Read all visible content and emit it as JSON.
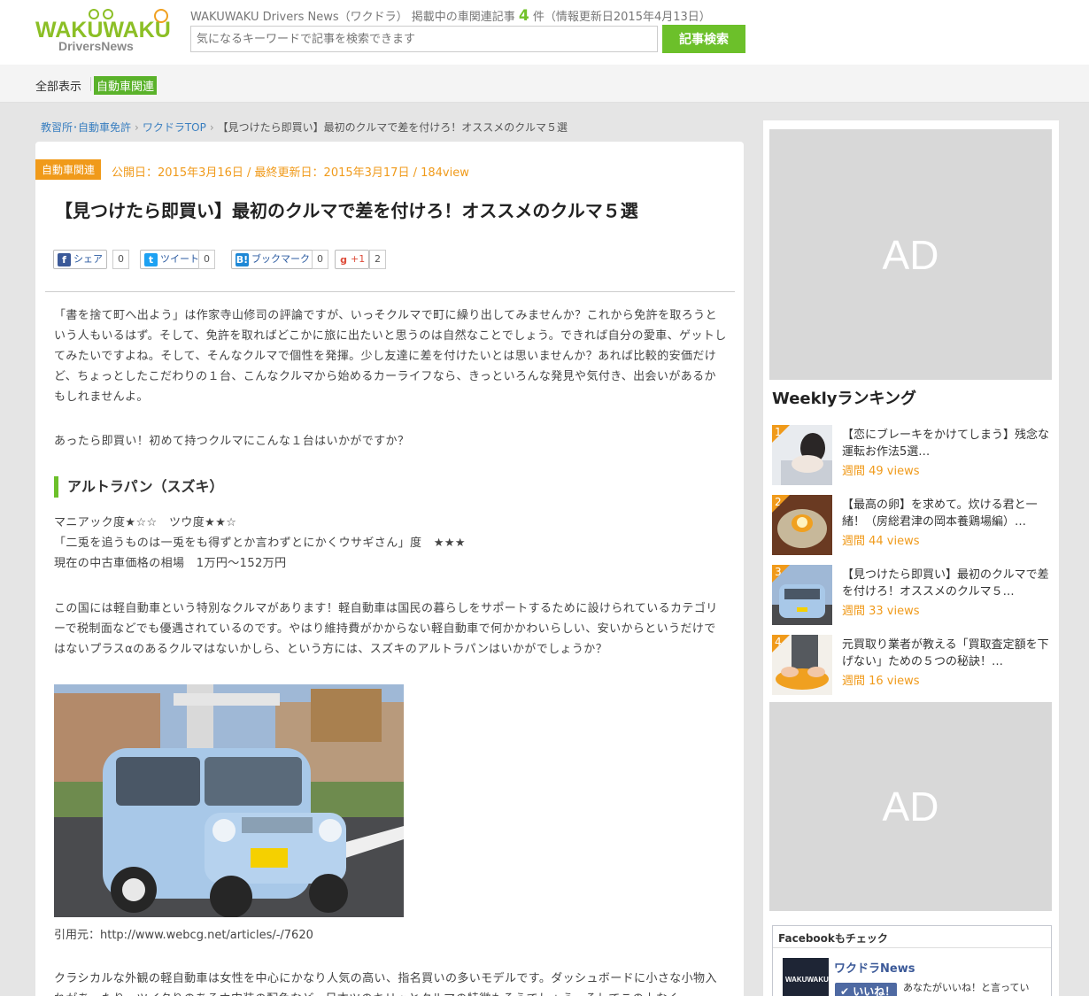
{
  "header": {
    "logo_top": "WAKUWAKU",
    "logo_sub": "DriversNews",
    "info_prefix": "WAKUWAKU Drivers News（ワクドラ） 掲載中の車関連記事",
    "info_count": "4",
    "info_suffix": "件（情報更新日2015年4月13日）",
    "search_placeholder": "気になるキーワードで記事を検索できます",
    "search_button": "記事検索"
  },
  "category_nav": {
    "all": "全部表示",
    "active": "自動車関連"
  },
  "breadcrumb": {
    "items": [
      "教習所･自動車免許",
      "ワクドラTOP"
    ],
    "current": "【見つけたら即買い】最初のクルマで差を付けろ！オススメのクルマ５選"
  },
  "article": {
    "category": "自動車関連",
    "meta": "公開日：2015年3月16日 / 最終更新日：2015年3月17日 / 184view",
    "title": "【見つけたら即買い】最初のクルマで差を付けろ！オススメのクルマ５選",
    "share": {
      "facebook_label": "シェア",
      "facebook_count": "0",
      "twitter_label": "ツイート",
      "twitter_count": "0",
      "hatena_label": "ブックマーク",
      "hatena_count": "0",
      "gplus_label": "+1",
      "gplus_count": "2"
    },
    "p1": "「書を捨て町へ出よう」は作家寺山修司の評論ですが、いっそクルマで町に繰り出してみませんか？これから免許を取ろうという人もいるはず。そして、免許を取ればどこかに旅に出たいと思うのは自然なことでしょう。できれば自分の愛車、ゲットしてみたいですよね。そして、そんなクルマで個性を発揮。少し友達に差を付けたいとは思いませんか？あれば比較的安価だけど、ちょっとしたこだわりの１台、こんなクルマから始めるカーライフなら、きっといろんな発見や気付き、出会いがあるかもしれませんよ。",
    "p2": "あったら即買い！初めて持つクルマにこんな１台はいかがですか？",
    "h2": "アルトラパン（スズキ）",
    "spec_1": "マニアック度★☆☆　ツウ度★★☆",
    "spec_2": "「二兎を追うものは一兎をも得ずとか言わずとにかくウサギさん」度　★★★",
    "spec_3": "現在の中古車価格の相場　1万円～152万円",
    "p4": "この国には軽自動車という特別なクルマがあります！軽自動車は国民の暮らしをサポートするために設けられているカテゴリーで税制面などでも優遇されているのです。やはり維持費がかからない軽自動車で何かかわいらしい、安いからというだけではないプラスαのあるクルマはないかしら、という方には、スズキのアルトラパンはいかがでしょうか？",
    "caption": "引用元：http://www.webcg.net/articles/-/7620",
    "p5": "クラシカルな外観の軽自動車は女性を中心にかなり人気の高い、指名買いの多いモデルです。ダッシュボードに小さな小物入れがあったり、ツイタりのあるホ内装の配色など、日本ツのキリッとクルマの特徴もそうでしょう。そしてこの上なく"
  },
  "sidebar": {
    "ad_1": "AD",
    "ad_2": "AD",
    "ranking_title": "Weeklyランキング",
    "ranking": [
      {
        "rank": "1",
        "title": "【恋にブレーキをかけてしまう】残念な運転お作法5選…",
        "views": "週間 49 views"
      },
      {
        "rank": "2",
        "title": "【最高の卵】を求めて。炊ける君と一緒！（房総君津の岡本養鶏場編）…",
        "views": "週間 44 views"
      },
      {
        "rank": "3",
        "title": "【見つけたら即買い】最初のクルマで差を付けろ！オススメのクルマ５…",
        "views": "週間 33 views"
      },
      {
        "rank": "4",
        "title": "元買取り業者が教える「買取査定額を下げない」ための５つの秘訣！…",
        "views": "週間 16 views"
      }
    ],
    "facebook": {
      "heading": "Facebookもチェック",
      "page_name": "ワクドラNews",
      "thumb_text": "WAKUWAKU",
      "like_button": "✔ いいね！",
      "liked_text": "あなたがいいね！と言ってい"
    }
  },
  "colors": {
    "brand_green": "#6cc02a",
    "accent_orange": "#f09a1a",
    "link_blue": "#3a7fc0"
  }
}
